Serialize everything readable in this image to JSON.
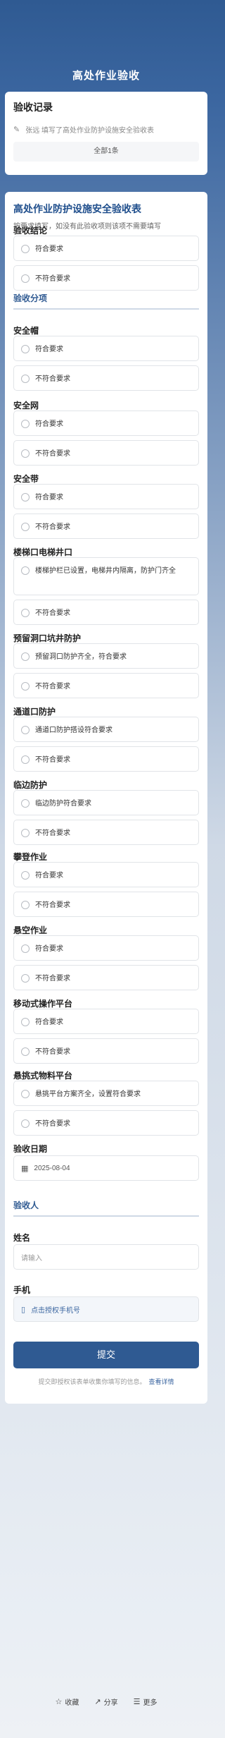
{
  "header": {
    "title": "高处作业验收"
  },
  "records": {
    "title": "验收记录",
    "entry": "张远 填写了高处作业防护设施安全验收表",
    "all_label": "全部1条"
  },
  "form": {
    "title": "高处作业防护设施安全验收表",
    "desc": "按要求填写，如没有此验收项则该项不需要填写",
    "conclusion": {
      "label": "验收结论",
      "options": [
        "符合要求",
        "不符合要求"
      ]
    },
    "section_items": "验收分项",
    "items": [
      {
        "label": "安全帽",
        "options": [
          "符合要求",
          "不符合要求"
        ]
      },
      {
        "label": "安全网",
        "options": [
          "符合要求",
          "不符合要求"
        ]
      },
      {
        "label": "安全带",
        "options": [
          "符合要求",
          "不符合要求"
        ]
      },
      {
        "label": "楼梯口电梯井口",
        "options": [
          "楼梯护栏已设置，电梯井内隔离，防护门齐全",
          "不符合要求"
        ]
      },
      {
        "label": "预留洞口坑井防护",
        "options": [
          "预留洞口防护齐全，符合要求",
          "不符合要求"
        ]
      },
      {
        "label": "通道口防护",
        "options": [
          "通道口防护搭设符合要求",
          "不符合要求"
        ]
      },
      {
        "label": "临边防护",
        "options": [
          "临边防护符合要求",
          "不符合要求"
        ]
      },
      {
        "label": "攀登作业",
        "options": [
          "符合要求",
          "不符合要求"
        ]
      },
      {
        "label": "悬空作业",
        "options": [
          "符合要求",
          "不符合要求"
        ]
      },
      {
        "label": "移动式操作平台",
        "options": [
          "符合要求",
          "不符合要求"
        ]
      },
      {
        "label": "悬挑式物料平台",
        "options": [
          "悬挑平台方案齐全，设置符合要求",
          "不符合要求"
        ]
      }
    ],
    "date": {
      "label": "验收日期",
      "value": "2025-08-04"
    },
    "section_people": "验收人",
    "name": {
      "label": "姓名",
      "placeholder": "请输入"
    },
    "phone": {
      "label": "手机",
      "value": "点击授权手机号"
    },
    "submit_label": "提交",
    "note": "提交即授权该表单收集你填写的信息。",
    "note_link": "查看详情"
  },
  "bottom": {
    "favorite": "收藏",
    "share": "分享",
    "more": "更多"
  },
  "colors": {
    "primary": "#2f5a92",
    "section": "#2f5a92"
  }
}
